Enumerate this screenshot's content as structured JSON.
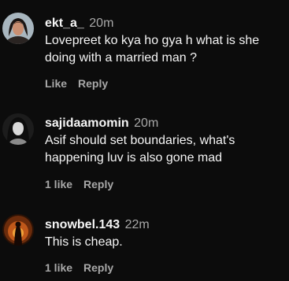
{
  "comments": [
    {
      "username": "ekt_a_",
      "time": "20m",
      "text": "Lovepreet ko kya ho gya h what is she doing with a married man ?",
      "likes": "",
      "like_label": "Like",
      "reply_label": "Reply",
      "avatar_icon": "user-avatar-icon"
    },
    {
      "username": "sajidaamomin",
      "time": "20m",
      "text": "Asif should set boundaries, what's happening luv is also gone mad",
      "likes": "1 like",
      "like_label": "1 like",
      "reply_label": "Reply",
      "avatar_icon": "user-avatar-icon"
    },
    {
      "username": "snowbel.143",
      "time": "22m",
      "text": "This is cheap.",
      "likes": "1 like",
      "like_label": "1 like",
      "reply_label": "Reply",
      "avatar_icon": "user-avatar-icon"
    }
  ],
  "colors": {
    "background": "#0c0c0c",
    "primary_text": "#f5f5f5",
    "secondary_text": "#a8a8a8"
  }
}
